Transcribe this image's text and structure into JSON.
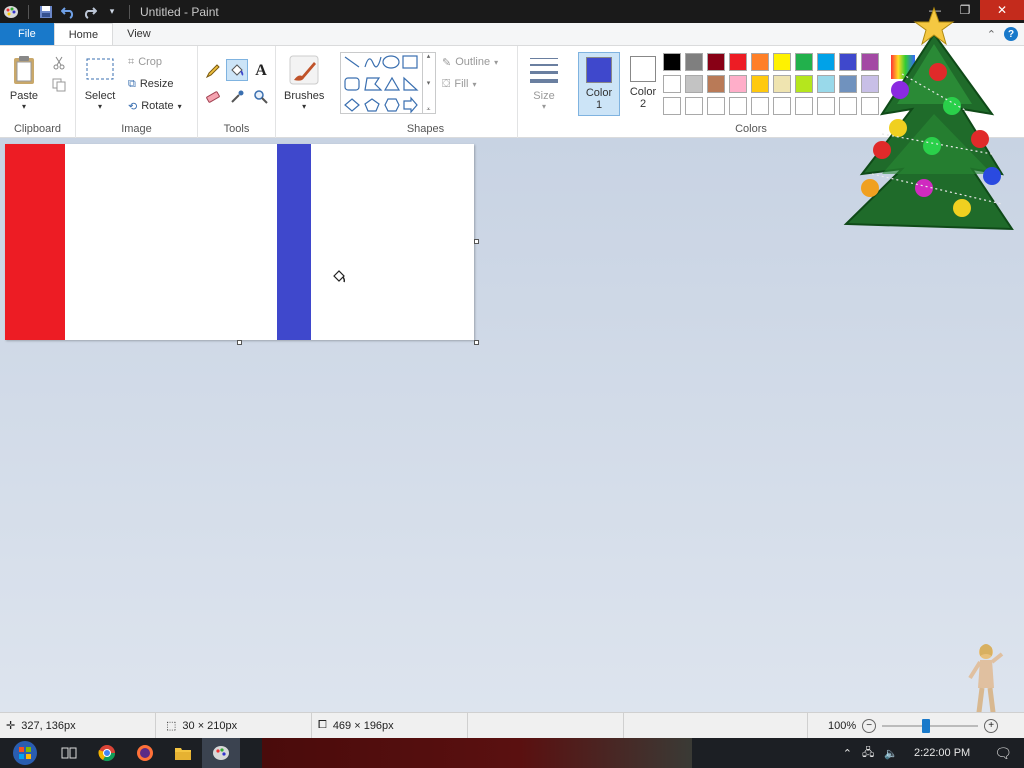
{
  "window": {
    "title": "Untitled - Paint",
    "minimize_glyph": "—",
    "maximize_glyph": "❐",
    "close_glyph": "✕"
  },
  "tabs": {
    "file": "File",
    "home": "Home",
    "view": "View"
  },
  "ribbon": {
    "clipboard": {
      "paste": "Paste",
      "group_label": "Clipboard"
    },
    "image": {
      "select": "Select",
      "crop": "Crop",
      "resize": "Resize",
      "rotate": "Rotate",
      "group_label": "Image"
    },
    "tools": {
      "group_label": "Tools"
    },
    "brushes": {
      "label": "Brushes"
    },
    "shapes": {
      "outline": "Outline",
      "fill": "Fill",
      "group_label": "Shapes"
    },
    "size": {
      "label": "Size"
    },
    "colors": {
      "color1_label_a": "Color",
      "color1_label_b": "1",
      "color2_label_a": "Color",
      "color2_label_b": "2",
      "color1_value": "#3f48cc",
      "color2_value": "#ffffff",
      "group_label": "Colors",
      "palette_row1": [
        "#000000",
        "#7f7f7f",
        "#880015",
        "#ed1c24",
        "#ff7f27",
        "#fff200",
        "#22b14c",
        "#00a2e8",
        "#3f48cc",
        "#a349a4"
      ],
      "palette_row2": [
        "#ffffff",
        "#c3c3c3",
        "#b97a57",
        "#ffaec9",
        "#ffc90e",
        "#efe4b0",
        "#b5e61d",
        "#99d9ea",
        "#7092be",
        "#c8bfe7"
      ],
      "palette_row3": [
        "#ffffff",
        "#ffffff",
        "#ffffff",
        "#ffffff",
        "#ffffff",
        "#ffffff",
        "#ffffff",
        "#ffffff",
        "#ffffff",
        "#ffffff"
      ]
    }
  },
  "canvas": {
    "stripes": [
      {
        "color": "#ed1c24"
      },
      {
        "color": "#3f48cc"
      }
    ]
  },
  "status": {
    "cursor_pos": "327, 136px",
    "selection_size": "30 × 210px",
    "image_size": "469 × 196px",
    "zoom": "100%"
  },
  "taskbar": {
    "time": "2:22:00 PM"
  }
}
